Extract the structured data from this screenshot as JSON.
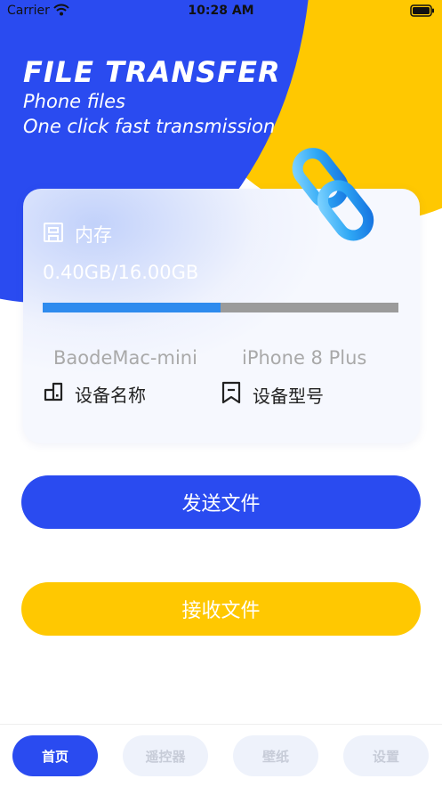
{
  "status_bar": {
    "carrier": "Carrier",
    "time": "10:28 AM"
  },
  "header": {
    "title": "FILE TRANSFER",
    "subtitle_line1": "Phone files",
    "subtitle_line2": "One click fast transmission"
  },
  "storage_card": {
    "memory_label": "内存",
    "memory_value": "0.40GB/16.00GB",
    "usage_fraction": 0.5,
    "device_name_value": "BaodeMac-mini",
    "device_model_value": "iPhone 8 Plus",
    "device_name_label": "设备名称",
    "device_model_label": "设备型号"
  },
  "actions": {
    "send_label": "发送文件",
    "receive_label": "接收文件"
  },
  "tabs": [
    {
      "label": "首页",
      "active": true
    },
    {
      "label": "遥控器",
      "active": false
    },
    {
      "label": "壁纸",
      "active": false
    },
    {
      "label": "设置",
      "active": false
    }
  ],
  "colors": {
    "primary_blue": "#2A4BF0",
    "accent_yellow": "#FFC801",
    "progress_fill": "#2E8BEE",
    "progress_track": "#9B9B9B"
  },
  "icons": [
    "wifi-icon",
    "battery-icon",
    "chain-link-icon",
    "storage-icon",
    "device-icon",
    "bookmark-icon"
  ]
}
